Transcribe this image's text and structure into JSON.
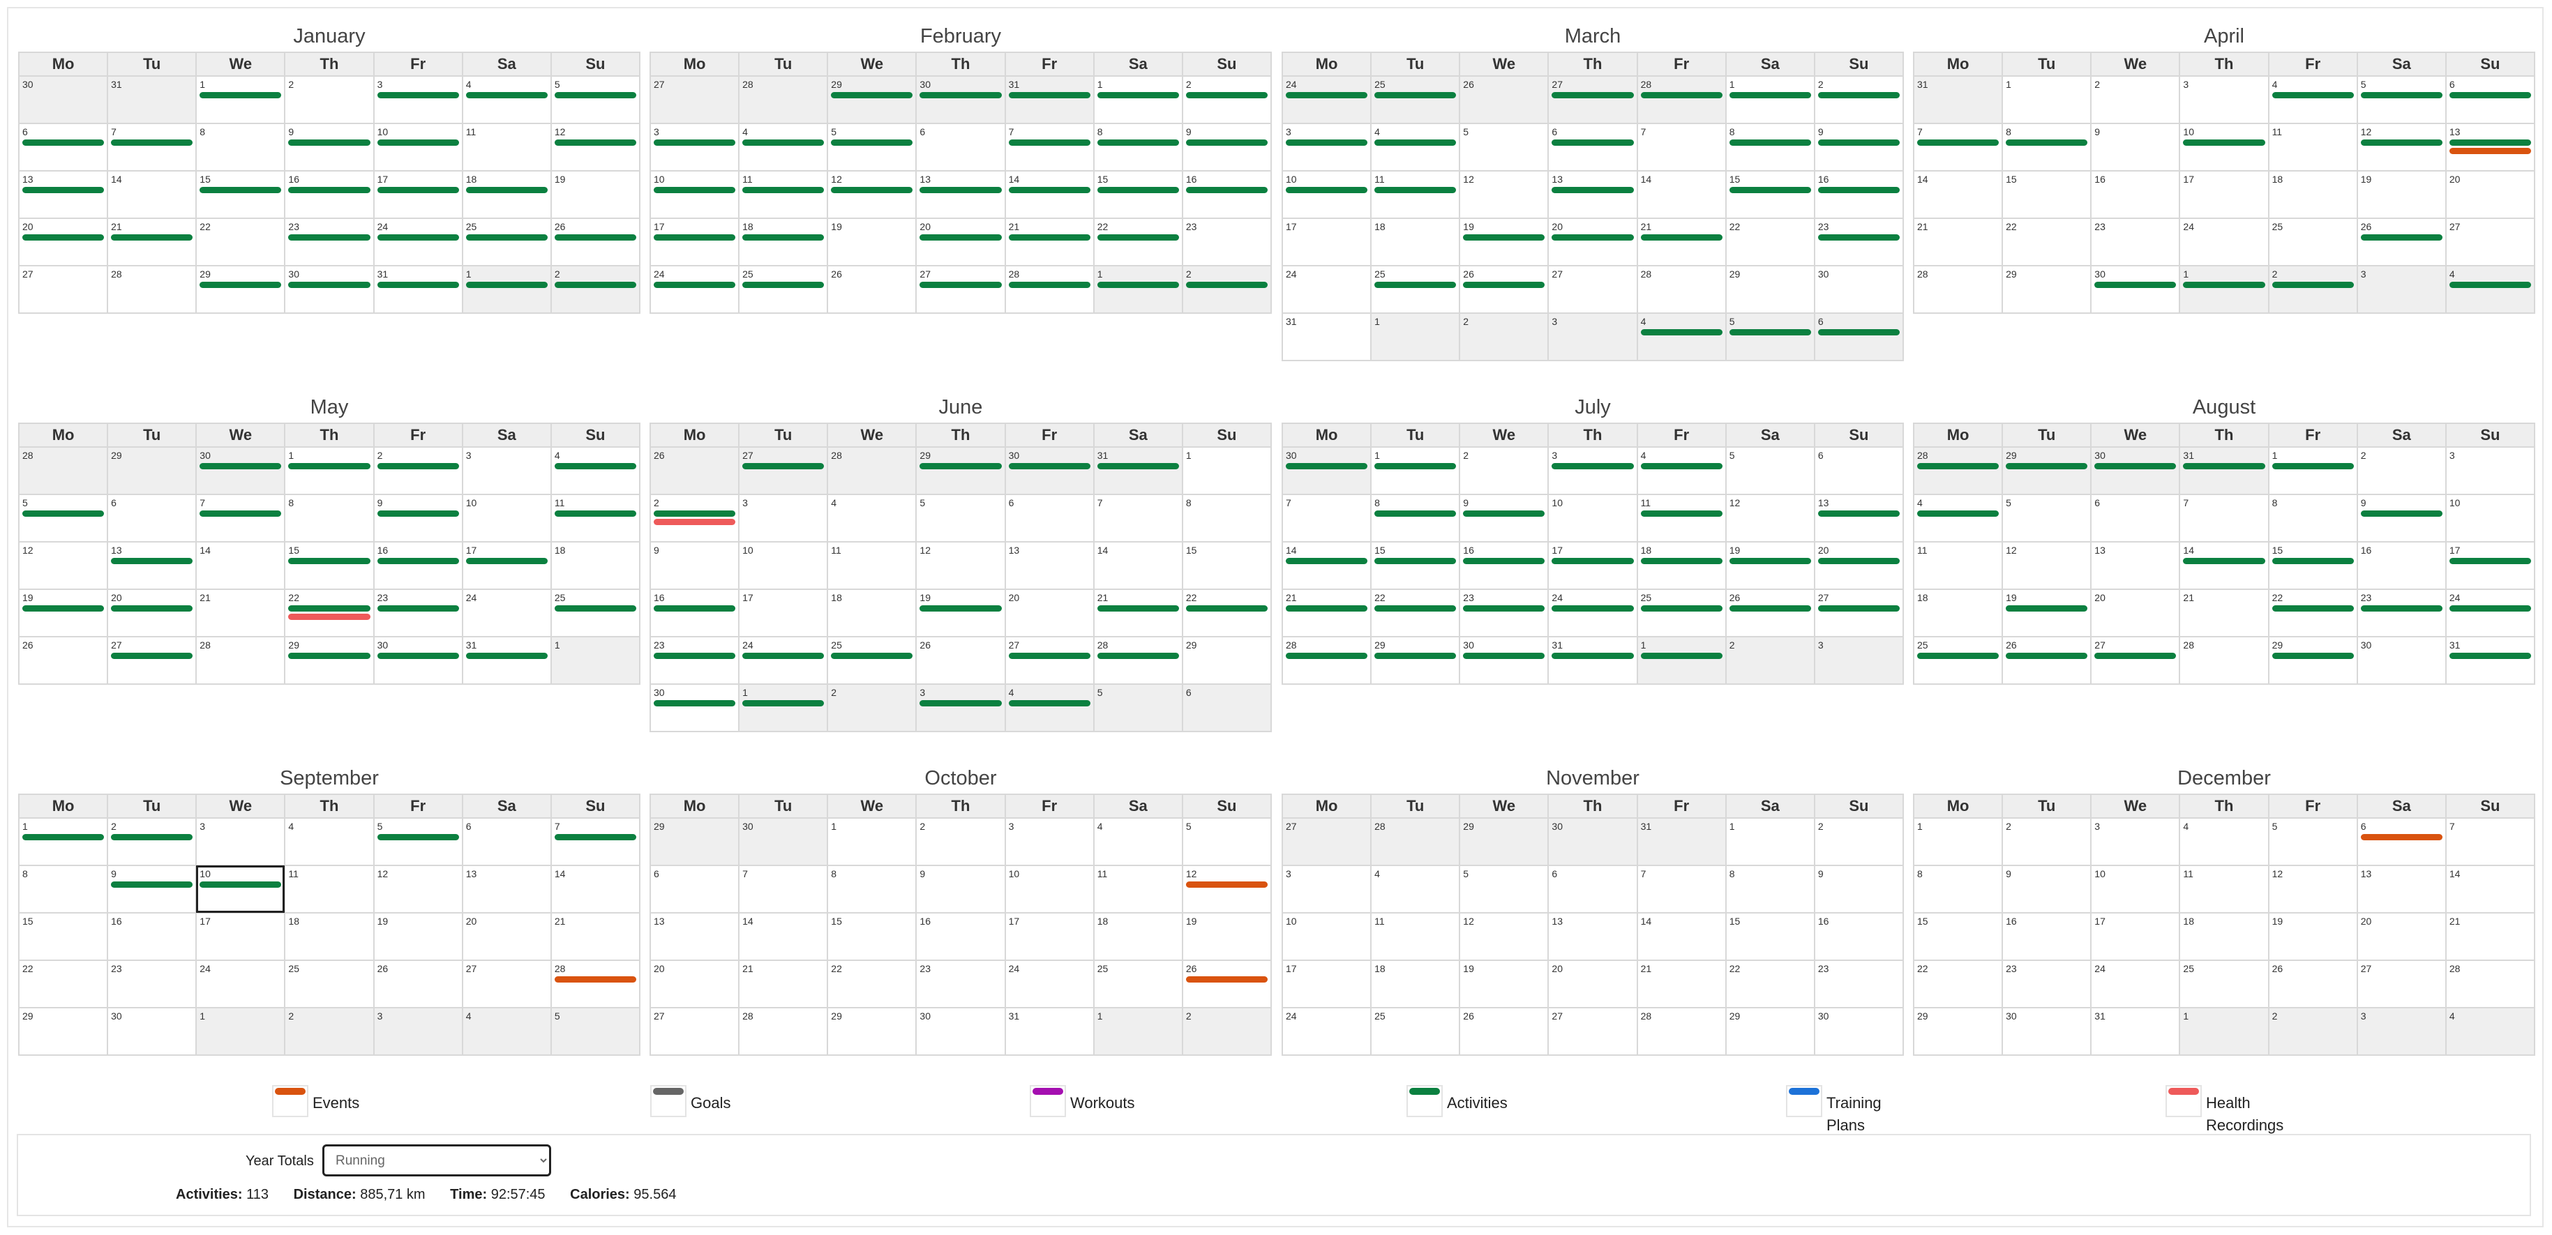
{
  "colors": {
    "events": "#d9530f",
    "goals": "#666666",
    "workouts": "#a40fb0",
    "activities": "#0b8040",
    "training_plans": "#1d72d8",
    "health": "#ee5a5a"
  },
  "weekdays": [
    "Mo",
    "Tu",
    "We",
    "Th",
    "Fr",
    "Sa",
    "Su"
  ],
  "months": [
    {
      "name": "January",
      "offset": 2,
      "days": 31,
      "prev_days": 31,
      "rows": 5,
      "marks": {
        "activities": [
          1,
          3,
          4,
          5,
          6,
          7,
          9,
          10,
          12,
          13,
          15,
          16,
          17,
          18,
          20,
          21,
          23,
          24,
          25,
          26,
          29,
          30,
          31,
          "n1",
          "n2"
        ],
        "prev_activities": []
      }
    },
    {
      "name": "February",
      "offset": 5,
      "days": 28,
      "prev_days": 31,
      "rows": 5,
      "marks": {
        "activities": [
          1,
          2,
          3,
          4,
          5,
          7,
          8,
          9,
          10,
          11,
          12,
          13,
          14,
          15,
          16,
          17,
          18,
          20,
          21,
          22,
          24,
          25,
          27,
          28,
          "n1",
          "n2"
        ],
        "prev_activities": [
          29,
          30,
          31
        ]
      }
    },
    {
      "name": "March",
      "offset": 5,
      "days": 31,
      "prev_days": 28,
      "rows": 6,
      "marks": {
        "activities": [
          1,
          2,
          3,
          4,
          6,
          8,
          9,
          10,
          11,
          13,
          15,
          16,
          19,
          20,
          21,
          23,
          25,
          26,
          "n4",
          "n5",
          "n6"
        ],
        "prev_activities": [
          24,
          25,
          27,
          28
        ]
      }
    },
    {
      "name": "April",
      "offset": 1,
      "days": 30,
      "prev_days": 31,
      "rows": 5,
      "marks": {
        "activities": [
          4,
          5,
          6,
          7,
          8,
          10,
          12,
          13,
          26,
          30,
          "n1",
          "n2",
          "n4"
        ],
        "events": [
          13
        ],
        "prev_activities": []
      }
    },
    {
      "name": "May",
      "offset": 3,
      "days": 31,
      "prev_days": 30,
      "rows": 5,
      "marks": {
        "activities": [
          1,
          2,
          4,
          5,
          7,
          9,
          11,
          13,
          15,
          16,
          17,
          19,
          20,
          22,
          23,
          25,
          27,
          29,
          30,
          31
        ],
        "health": [
          22
        ],
        "prev_activities": [
          30
        ]
      }
    },
    {
      "name": "June",
      "offset": 6,
      "days": 30,
      "prev_days": 31,
      "rows": 6,
      "marks": {
        "activities": [
          2,
          16,
          19,
          21,
          22,
          23,
          24,
          25,
          27,
          28,
          30,
          "n1",
          "n3",
          "n4"
        ],
        "health": [
          2
        ],
        "prev_activities": [
          27,
          29,
          30,
          31
        ]
      }
    },
    {
      "name": "July",
      "offset": 1,
      "days": 31,
      "prev_days": 30,
      "rows": 5,
      "marks": {
        "activities": [
          1,
          3,
          4,
          8,
          9,
          11,
          13,
          14,
          15,
          16,
          17,
          18,
          19,
          20,
          21,
          22,
          23,
          24,
          25,
          26,
          27,
          28,
          29,
          30,
          31,
          "n1"
        ],
        "prev_activities": [
          30
        ]
      }
    },
    {
      "name": "August",
      "offset": 4,
      "days": 31,
      "prev_days": 31,
      "rows": 5,
      "marks": {
        "activities": [
          1,
          4,
          9,
          14,
          15,
          17,
          19,
          22,
          23,
          24,
          25,
          26,
          27,
          29,
          31
        ],
        "prev_activities": [
          28,
          29,
          30,
          31
        ]
      }
    },
    {
      "name": "September",
      "offset": 0,
      "days": 30,
      "prev_days": 31,
      "rows": 5,
      "marks": {
        "activities": [
          1,
          2,
          5,
          7,
          9,
          10
        ],
        "events": [
          28
        ],
        "prev_activities": []
      },
      "today": 10
    },
    {
      "name": "October",
      "offset": 2,
      "days": 31,
      "prev_days": 30,
      "rows": 5,
      "marks": {
        "activities": [],
        "events": [
          12,
          26
        ],
        "prev_activities": []
      }
    },
    {
      "name": "November",
      "offset": 5,
      "days": 30,
      "prev_days": 31,
      "rows": 5,
      "marks": {
        "activities": [],
        "prev_activities": []
      }
    },
    {
      "name": "December",
      "offset": 0,
      "days": 31,
      "prev_days": 30,
      "rows": 5,
      "marks": {
        "activities": [],
        "events": [
          6
        ],
        "prev_activities": []
      }
    }
  ],
  "legend": [
    {
      "key": "events",
      "label": "Events"
    },
    {
      "key": "goals",
      "label": "Goals"
    },
    {
      "key": "workouts",
      "label": "Workouts"
    },
    {
      "key": "activities",
      "label": "Activities"
    },
    {
      "key": "training_plans",
      "label": "Training Plans"
    },
    {
      "key": "health",
      "label": "Health Recordings"
    }
  ],
  "totals": {
    "year_label": "Year Totals",
    "sport_selected": "Running",
    "activities_label": "Activities:",
    "activities_value": "113",
    "distance_label": "Distance:",
    "distance_value": "885,71 km",
    "time_label": "Time:",
    "time_value": "92:57:45",
    "calories_label": "Calories:",
    "calories_value": "95.564"
  }
}
